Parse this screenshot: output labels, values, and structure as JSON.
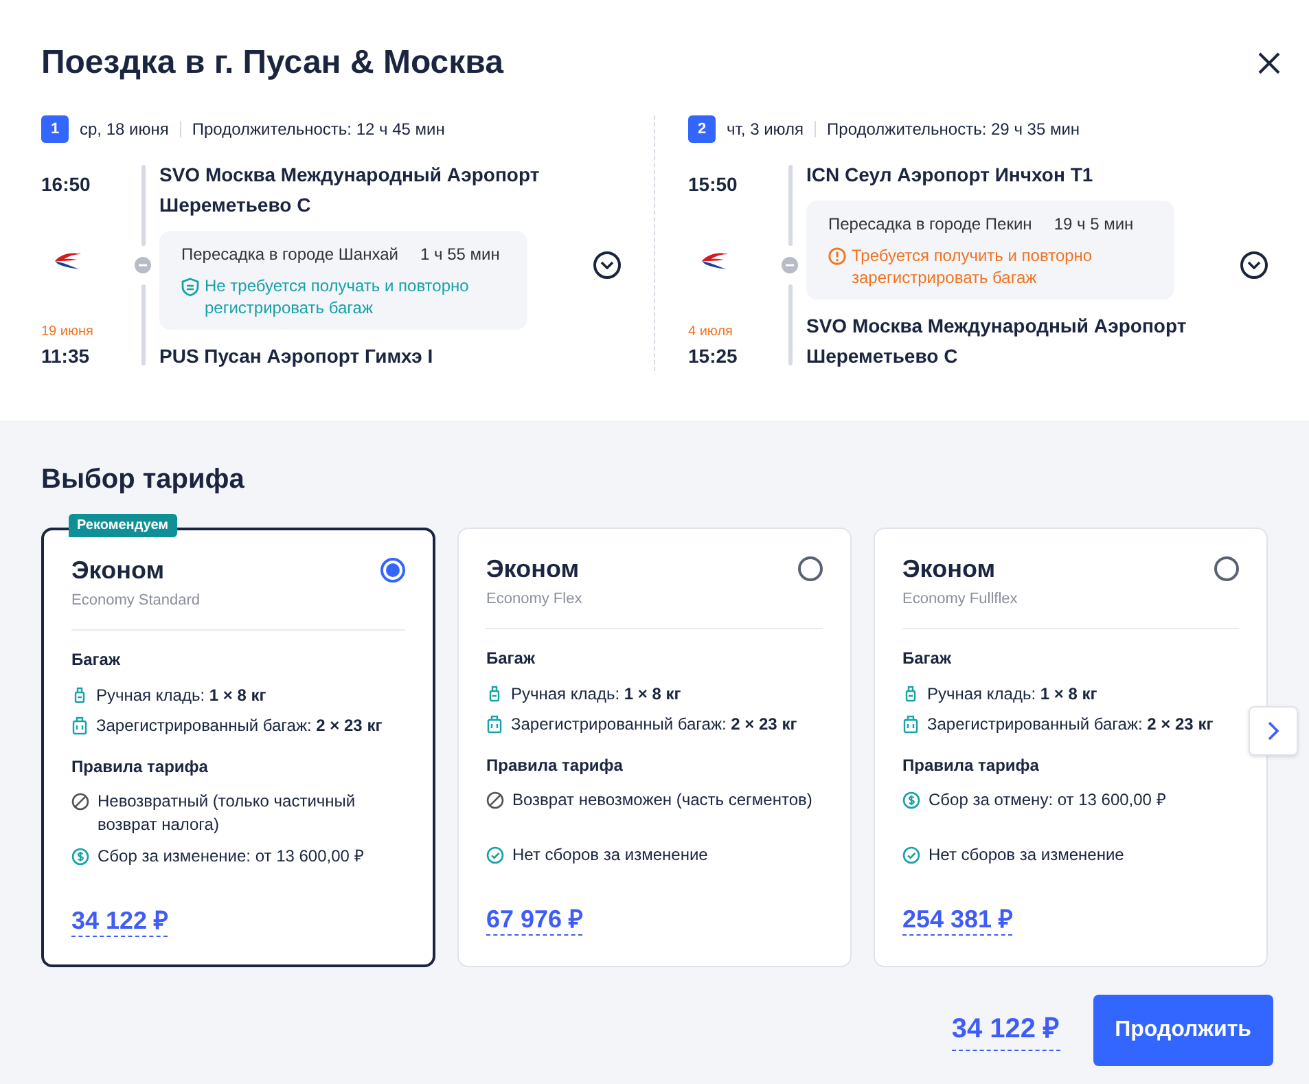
{
  "dialog": {
    "title": "Поездка в г. Пусан & Москва"
  },
  "segments": [
    {
      "number": "1",
      "date": "ср, 18 июня",
      "duration": "Продолжительность: 12 ч 45 мин",
      "depart_time": "16:50",
      "depart_airport": "SVO Москва Международный Аэропорт Шереметьево C",
      "transfer": {
        "city": "Пересадка в городе Шанхай",
        "time": "1 ч 55 мин",
        "note": {
          "kind": "ok",
          "text": "Не требуется получать и повторно регистрировать багаж"
        }
      },
      "arrive_date": "19 июня",
      "arrive_time": "11:35",
      "arrive_airport": "PUS Пусан Аэропорт Гимхэ I"
    },
    {
      "number": "2",
      "date": "чт, 3 июля",
      "duration": "Продолжительность: 29 ч 35 мин",
      "depart_time": "15:50",
      "depart_airport": "ICN Сеул Аэропорт Инчхон T1",
      "transfer": {
        "city": "Пересадка в городе Пекин",
        "time": "19 ч 5 мин",
        "note": {
          "kind": "warn",
          "text": "Требуется получить и повторно зарегистрировать багаж"
        }
      },
      "arrive_date": "4 июля",
      "arrive_time": "15:25",
      "arrive_airport": "SVO Москва Международный Аэропорт Шереметьево C"
    }
  ],
  "tariffs": {
    "title": "Выбор тарифа",
    "cards": [
      {
        "badge": "Рекомендуем",
        "selected": true,
        "name": "Эконом",
        "subtitle": "Economy Standard",
        "baggage_title": "Багаж",
        "baggage": [
          "Ручная кладь: **1 × 8 кг**",
          "Зарегистрированный багаж: **2 × 23 кг**"
        ],
        "rules_title": "Правила тарифа",
        "rules": [
          {
            "kind": "no",
            "text": "Невозвратный (только частичный возврат налога)"
          },
          {
            "kind": "fee",
            "text": "Сбор за изменение: от 13 600,00 ₽"
          }
        ],
        "price": "34 122 ₽"
      },
      {
        "selected": false,
        "name": "Эконом",
        "subtitle": "Economy Flex",
        "baggage_title": "Багаж",
        "baggage": [
          "Ручная кладь: **1 × 8 кг**",
          "Зарегистрированный багаж: **2 × 23 кг**"
        ],
        "rules_title": "Правила тарифа",
        "rules": [
          {
            "kind": "no",
            "text": "Возврат невозможен (часть сегментов)"
          },
          {
            "kind": "ok",
            "text": "Нет сборов за изменение"
          }
        ],
        "price": "67 976 ₽"
      },
      {
        "selected": false,
        "name": "Эконом",
        "subtitle": "Economy Fullflex",
        "baggage_title": "Багаж",
        "baggage": [
          "Ручная кладь: **1 × 8 кг**",
          "Зарегистрированный багаж: **2 × 23 кг**"
        ],
        "rules_title": "Правила тарифа",
        "rules": [
          {
            "kind": "fee",
            "text": "Сбор за отмену: от 13 600,00 ₽"
          },
          {
            "kind": "ok",
            "text": "Нет сборов за изменение"
          }
        ],
        "price": "254 381 ₽"
      }
    ]
  },
  "footer": {
    "total": "34 122 ₽",
    "continue_button": "Продолжить"
  }
}
